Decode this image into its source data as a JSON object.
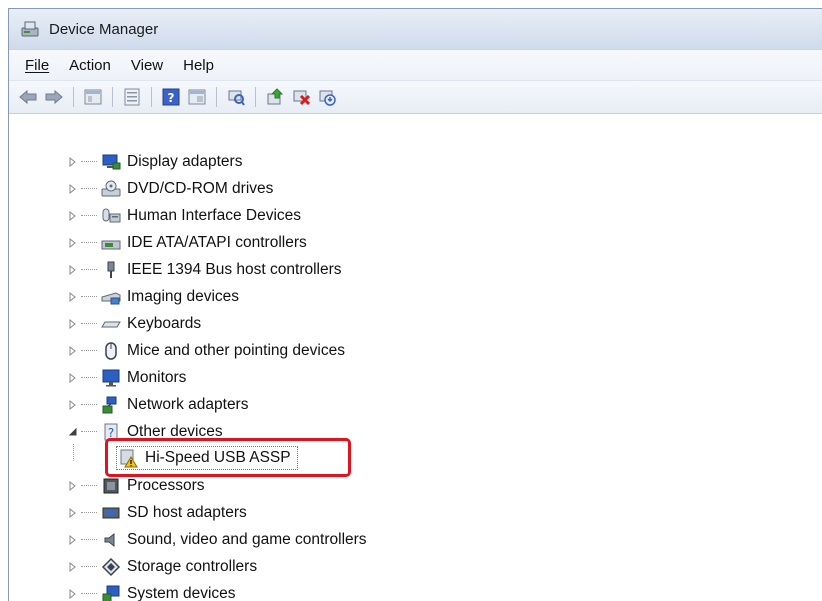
{
  "window": {
    "title": "Device Manager",
    "icon": "device-manager-icon"
  },
  "menu": [
    {
      "id": "file",
      "label": "File"
    },
    {
      "id": "action",
      "label": "Action"
    },
    {
      "id": "view",
      "label": "View"
    },
    {
      "id": "help",
      "label": "Help"
    }
  ],
  "toolbar": [
    "back-arrow-icon",
    "forward-arrow-icon",
    "show-hide-console-tree-icon",
    "properties-icon",
    "help-icon",
    "view-icon",
    "scan-hardware-icon",
    "update-driver-icon",
    "uninstall-icon",
    "disable-icon"
  ],
  "tree": {
    "categories": [
      {
        "label": "Display adapters",
        "icon": "monitor-icon",
        "expanded": false
      },
      {
        "label": "DVD/CD-ROM drives",
        "icon": "disc-drive-icon",
        "expanded": false
      },
      {
        "label": "Human Interface Devices",
        "icon": "hid-icon",
        "expanded": false
      },
      {
        "label": "IDE ATA/ATAPI controllers",
        "icon": "ide-controller-icon",
        "expanded": false
      },
      {
        "label": "IEEE 1394 Bus host controllers",
        "icon": "firewire-icon",
        "expanded": false
      },
      {
        "label": "Imaging devices",
        "icon": "scanner-icon",
        "expanded": false
      },
      {
        "label": "Keyboards",
        "icon": "keyboard-icon",
        "expanded": false
      },
      {
        "label": "Mice and other pointing devices",
        "icon": "mouse-icon",
        "expanded": false
      },
      {
        "label": "Monitors",
        "icon": "monitor-icon",
        "expanded": false
      },
      {
        "label": "Network adapters",
        "icon": "network-icon",
        "expanded": false
      },
      {
        "label": "Other devices",
        "icon": "unknown-device-icon",
        "expanded": true
      },
      {
        "label": "Processors",
        "icon": "processor-icon",
        "expanded": false
      },
      {
        "label": "SD host adapters",
        "icon": "sd-card-icon",
        "expanded": false
      },
      {
        "label": "Sound, video and game controllers",
        "icon": "speaker-icon",
        "expanded": false
      },
      {
        "label": "Storage controllers",
        "icon": "storage-icon",
        "expanded": false
      },
      {
        "label": "System devices",
        "icon": "system-icon",
        "expanded": false
      }
    ],
    "other_devices_child": {
      "label": "Hi-Speed USB ASSP",
      "icon": "warning-device-icon",
      "highlight_color": "#e0141e"
    }
  }
}
